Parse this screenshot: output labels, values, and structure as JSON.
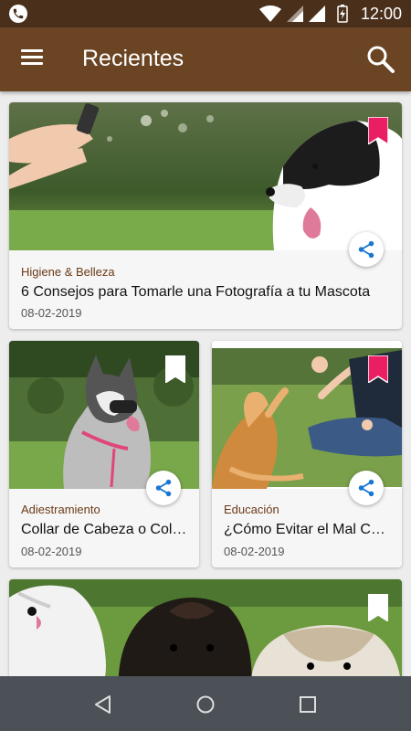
{
  "status_bar": {
    "time": "12:00"
  },
  "app_bar": {
    "title": "Recientes"
  },
  "cards": [
    {
      "category": "Higiene & Belleza",
      "title": "6 Consejos para Tomarle una Fotografía a tu Mascota",
      "date": "08-02-2019",
      "bookmarked": true
    },
    {
      "category": "Adiestramiento",
      "title": "Collar de Cabeza o Collar Antitirones",
      "date": "08-02-2019",
      "bookmarked": false
    },
    {
      "category": "Educación",
      "title": "¿Cómo Evitar el Mal Comportamiento?",
      "date": "08-02-2019",
      "bookmarked": true
    },
    {
      "bookmarked": false
    }
  ],
  "icons": {
    "menu": "hamburger-menu-icon",
    "search": "search-icon",
    "bookmark": "bookmark-icon",
    "share": "share-icon",
    "back": "back-triangle-icon",
    "home": "home-circle-icon",
    "recents": "recents-square-icon"
  },
  "colors": {
    "status_bar": "#4a2f1b",
    "app_bar": "#6b4423",
    "bookmark_active": "#e91e63",
    "share_icon": "#1976d2",
    "category_text": "#6b3a16",
    "nav_bar": "#4b5157"
  }
}
